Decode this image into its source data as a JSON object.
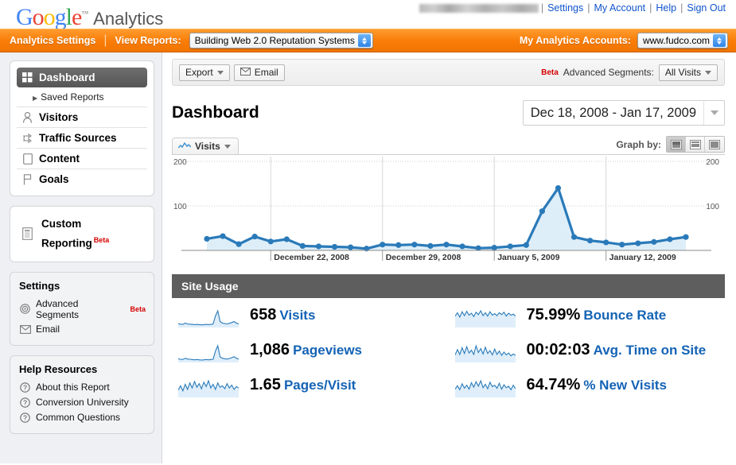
{
  "header": {
    "logo_google": "Google",
    "logo_analytics": "Analytics",
    "account_email_redacted": "",
    "links": [
      {
        "label": "Settings"
      },
      {
        "label": "My Account"
      },
      {
        "label": "Help"
      },
      {
        "label": "Sign Out"
      }
    ],
    "separator": "|"
  },
  "orange_bar": {
    "analytics_settings": "Analytics Settings",
    "divider": "|",
    "view_reports_label": "View Reports:",
    "view_reports_value": "Building Web 2.0 Reputation Systems",
    "my_accounts_label": "My Analytics Accounts:",
    "my_accounts_value": "www.fudco.com"
  },
  "sidebar": {
    "nav": [
      {
        "label": "Dashboard",
        "icon": "grid-icon",
        "active": true
      },
      {
        "label": "Saved Reports",
        "icon": "triangle-icon",
        "sub": true
      },
      {
        "label": "Visitors",
        "icon": "person-icon"
      },
      {
        "label": "Traffic Sources",
        "icon": "arrows-icon"
      },
      {
        "label": "Content",
        "icon": "page-icon"
      },
      {
        "label": "Goals",
        "icon": "flag-icon"
      }
    ],
    "custom_reporting": {
      "line1": "Custom",
      "line2": "Reporting",
      "badge": "Beta"
    },
    "settings": {
      "title": "Settings",
      "items": [
        {
          "label": "Advanced Segments",
          "icon": "target-icon",
          "badge": "Beta"
        },
        {
          "label": "Email",
          "icon": "envelope-icon",
          "badge": ""
        }
      ]
    },
    "help": {
      "title": "Help Resources",
      "items": [
        {
          "label": "About this Report",
          "icon": "question-icon"
        },
        {
          "label": "Conversion University",
          "icon": "question-icon"
        },
        {
          "label": "Common Questions",
          "icon": "question-icon"
        }
      ]
    }
  },
  "toolbar": {
    "export_label": "Export",
    "email_label": "Email",
    "beta_badge": "Beta",
    "advanced_segments_label": "Advanced Segments:",
    "advanced_segments_value": "All Visits"
  },
  "main": {
    "page_title": "Dashboard",
    "date_range": "Dec 18, 2008 - Jan 17, 2009"
  },
  "chart_panel": {
    "metric_tab": "Visits",
    "graph_by_label": "Graph by:",
    "graph_by_options": [
      "day",
      "week",
      "month"
    ],
    "graph_by_selected": "day"
  },
  "site_usage": {
    "title": "Site Usage",
    "metrics": [
      {
        "value": "658",
        "label": "Visits",
        "col": 0
      },
      {
        "value": "1,086",
        "label": "Pageviews",
        "col": 0
      },
      {
        "value": "1.65",
        "label": "Pages/Visit",
        "col": 0
      },
      {
        "value": "75.99%",
        "label": "Bounce Rate",
        "col": 1
      },
      {
        "value": "00:02:03",
        "label": "Avg. Time on Site",
        "col": 1
      },
      {
        "value": "64.74%",
        "label": "% New Visits",
        "col": 1
      }
    ]
  },
  "colors": {
    "accent_orange": "#f97d08",
    "link_blue": "#1155cc",
    "chart_blue": "#2a7ab9",
    "chart_fill": "#deeef8",
    "beta_red": "#d40000",
    "header_gray": "#5e5e5e"
  },
  "chart_data": {
    "type": "area",
    "title": "Visits",
    "xlabel": "",
    "ylabel": "Visits",
    "ylim": [
      0,
      200
    ],
    "yticks": [
      100,
      200
    ],
    "ytick_labels_left": [
      "100",
      "200"
    ],
    "ytick_labels_right": [
      "100",
      "200"
    ],
    "grid": true,
    "legend": "none",
    "x_tick_labels": [
      "December 22, 2008",
      "December 29, 2008",
      "January 5, 2009",
      "January 12, 2009"
    ],
    "x_tick_indices": [
      4,
      11,
      18,
      25
    ],
    "x_start": "Dec 18, 2008",
    "x_end": "Jan 17, 2009",
    "categories": [
      "Dec 18, 2008",
      "Dec 19, 2008",
      "Dec 20, 2008",
      "Dec 21, 2008",
      "Dec 22, 2008",
      "Dec 23, 2008",
      "Dec 24, 2008",
      "Dec 25, 2008",
      "Dec 26, 2008",
      "Dec 27, 2008",
      "Dec 28, 2008",
      "Dec 29, 2008",
      "Dec 30, 2008",
      "Dec 31, 2008",
      "Jan 1, 2009",
      "Jan 2, 2009",
      "Jan 3, 2009",
      "Jan 4, 2009",
      "Jan 5, 2009",
      "Jan 6, 2009",
      "Jan 7, 2009",
      "Jan 8, 2009",
      "Jan 9, 2009",
      "Jan 10, 2009",
      "Jan 11, 2009",
      "Jan 12, 2009",
      "Jan 13, 2009",
      "Jan 14, 2009",
      "Jan 15, 2009",
      "Jan 16, 2009",
      "Jan 17, 2009"
    ],
    "values": [
      26,
      32,
      14,
      31,
      20,
      25,
      10,
      9,
      8,
      7,
      4,
      13,
      12,
      13,
      10,
      13,
      9,
      5,
      6,
      9,
      12,
      88,
      140,
      30,
      22,
      18,
      13,
      16,
      19,
      25,
      30
    ],
    "series": [
      {
        "name": "Visits",
        "values": [
          26,
          32,
          14,
          31,
          20,
          25,
          10,
          9,
          8,
          7,
          4,
          13,
          12,
          13,
          10,
          13,
          9,
          5,
          6,
          9,
          12,
          88,
          140,
          30,
          22,
          18,
          13,
          16,
          19,
          25,
          30
        ]
      }
    ],
    "sparklines": {
      "visits": [
        12,
        10,
        9,
        14,
        11,
        10,
        9,
        8,
        9,
        8,
        7,
        8,
        9,
        8,
        9,
        10,
        42,
        62,
        20,
        14,
        12,
        11,
        13,
        16,
        20,
        14,
        11
      ],
      "pageviews": [
        11,
        9,
        8,
        13,
        10,
        9,
        8,
        7,
        8,
        7,
        6,
        7,
        8,
        7,
        8,
        9,
        40,
        60,
        18,
        13,
        11,
        10,
        12,
        15,
        19,
        13,
        10
      ],
      "pages_visit": [
        18,
        30,
        16,
        34,
        20,
        38,
        24,
        42,
        26,
        36,
        22,
        40,
        28,
        44,
        24,
        34,
        20,
        38,
        26,
        30,
        22,
        36,
        24,
        32,
        20,
        28,
        24
      ],
      "bounce_rate": [
        44,
        58,
        40,
        62,
        46,
        64,
        48,
        56,
        42,
        60,
        50,
        66,
        46,
        58,
        44,
        62,
        48,
        54,
        46,
        58,
        50,
        60,
        44,
        56,
        48,
        52,
        44
      ],
      "avg_time": [
        28,
        50,
        30,
        58,
        34,
        62,
        36,
        48,
        30,
        66,
        38,
        54,
        32,
        60,
        34,
        46,
        28,
        52,
        30,
        44,
        26,
        40,
        28,
        36,
        24,
        32,
        26
      ],
      "new_visits": [
        30,
        44,
        28,
        52,
        34,
        46,
        30,
        56,
        38,
        60,
        42,
        64,
        36,
        50,
        32,
        58,
        40,
        46,
        34,
        54,
        30,
        48,
        36,
        42,
        28,
        46,
        32
      ]
    }
  }
}
